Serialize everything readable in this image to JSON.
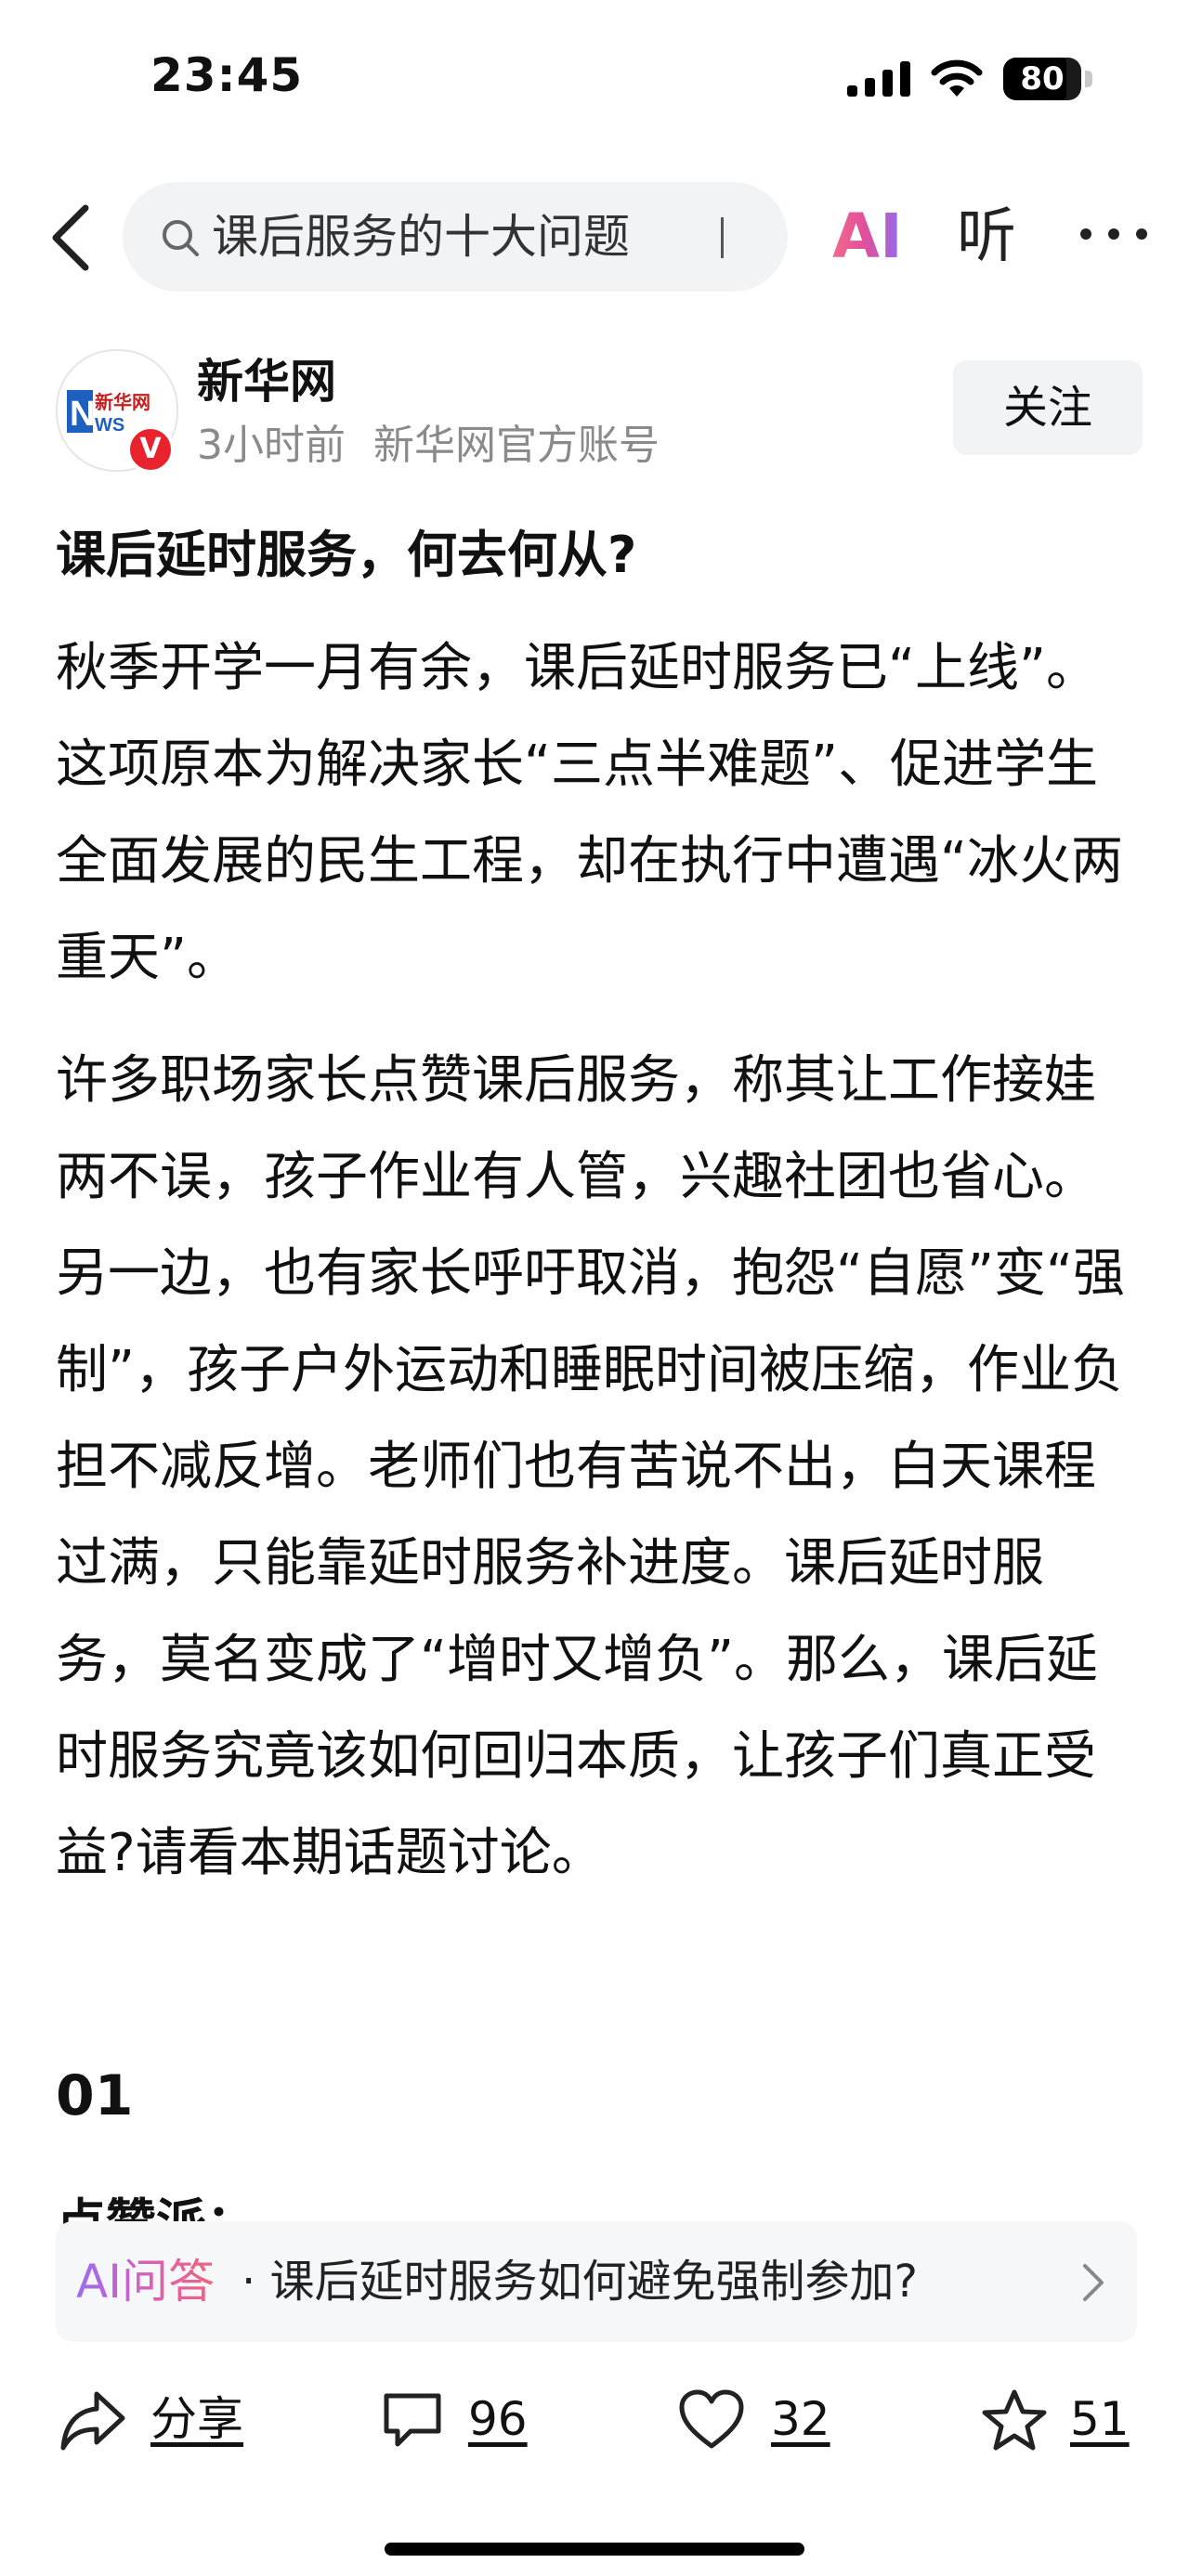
{
  "status_bar": {
    "time": "23:45",
    "battery": "80",
    "icons": [
      "signal-icon",
      "wifi-icon",
      "battery-icon"
    ]
  },
  "nav": {
    "search_text": "课后服务的十大问题",
    "ai_label": "AI",
    "listen_label": "听",
    "icons": [
      "back-arrow-icon",
      "search-icon",
      "more-icon"
    ]
  },
  "author": {
    "name": "新华网",
    "time_ago": "3小时前",
    "account_type": "新华网官方账号",
    "verified_badge": "V",
    "follow_label": "关注",
    "logo_text": "新华网"
  },
  "article": {
    "title": "课后延时服务，何去何从?",
    "paragraphs": [
      "秋季开学一月有余，课后延时服务已“上线”。这项原本为解决家长“三点半难题”、促进学生全面发展的民生工程，却在执行中遭遇“冰火两重天”。",
      "许多职场家长点赞课后服务，称其让工作接娃两不误，孩子作业有人管，兴趣社团也省心。另一边，也有家长呼吁取消，抱怨“自愿”变“强制”，孩子户外运动和睡眠时间被压缩，作业负担不减反增。老师们也有苦说不出，白天课程过满，只能靠延时服务补进度。课后延时服务，莫名变成了“增时又增负”。那么，课后延时服务究竟该如何回归本质，让孩子们真正受益?请看本期话题讨论。"
    ],
    "section_number": "01",
    "section_heading_partial": "点赞派："
  },
  "ai_qa": {
    "tag": "AI问答",
    "separator": "·",
    "question": "课后延时服务如何避免强制参加?"
  },
  "actions": {
    "share_label": "分享",
    "comments_count": "96",
    "likes_count": "32",
    "favorites_count": "51"
  },
  "colors": {
    "accent_gradient_start": "#f26a8d",
    "accent_gradient_end": "#8e6cf2",
    "verified_red": "#e8232d",
    "muted_text": "#8a8a8a",
    "pill_background": "#f2f3f5"
  }
}
